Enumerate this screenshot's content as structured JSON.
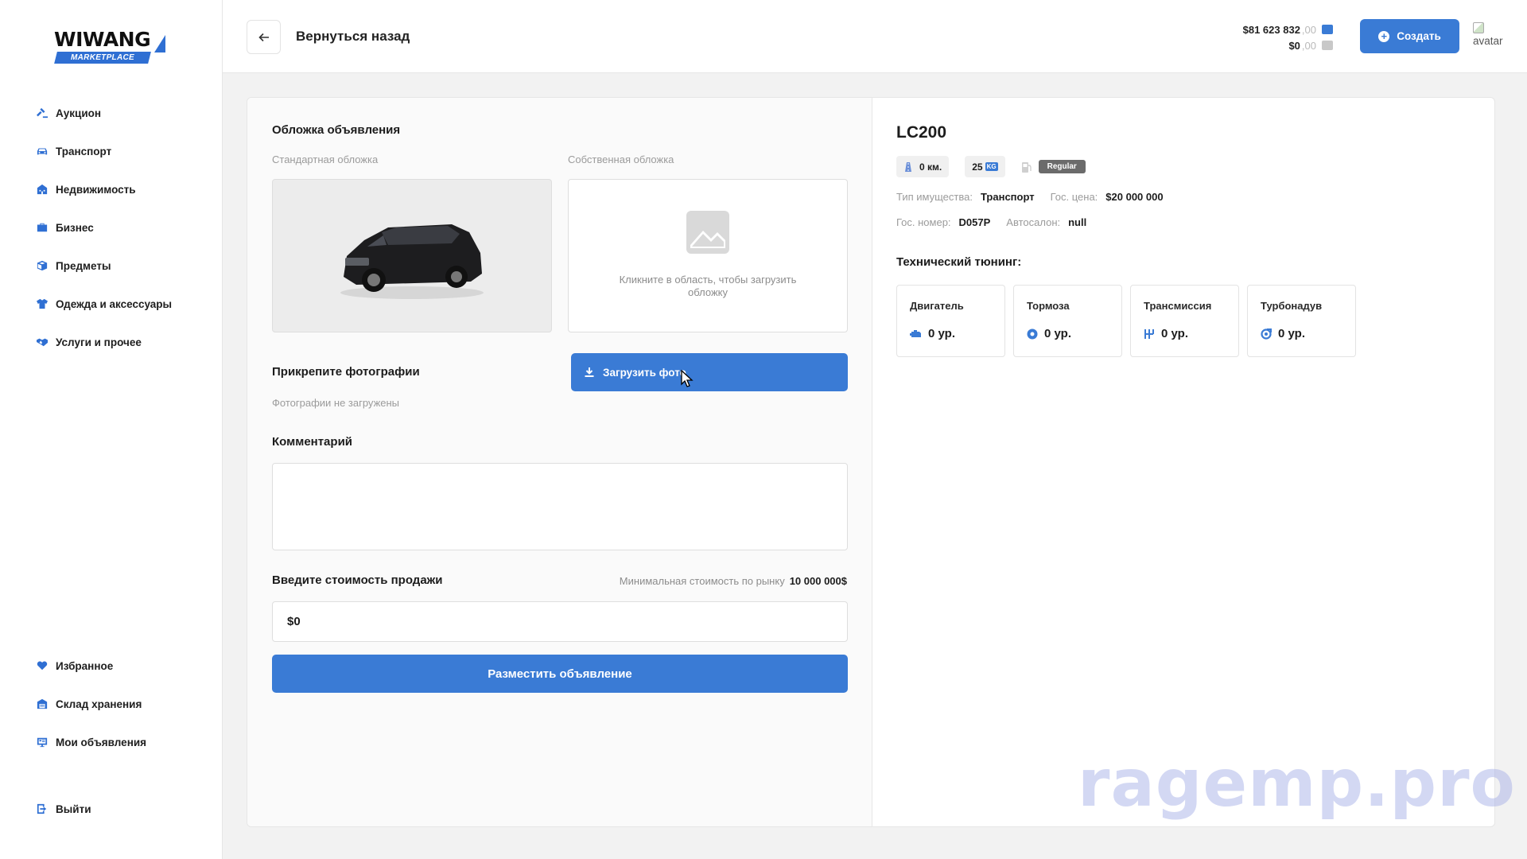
{
  "logo": {
    "brand": "WIWANG",
    "tag": "MARKETPLACE"
  },
  "sidebar": {
    "items": [
      {
        "label": "Аукцион",
        "icon": "gavel-icon"
      },
      {
        "label": "Транспорт",
        "icon": "car-icon"
      },
      {
        "label": "Недвижимость",
        "icon": "building-icon"
      },
      {
        "label": "Бизнес",
        "icon": "briefcase-icon"
      },
      {
        "label": "Предметы",
        "icon": "box-icon"
      },
      {
        "label": "Одежда и аксессуары",
        "icon": "shirt-icon"
      },
      {
        "label": "Услуги и прочее",
        "icon": "handshake-icon"
      }
    ],
    "bottom_items": [
      {
        "label": "Избранное",
        "icon": "heart-icon"
      },
      {
        "label": "Склад хранения",
        "icon": "warehouse-icon"
      },
      {
        "label": "Мои объявления",
        "icon": "listings-icon"
      }
    ],
    "logout": {
      "label": "Выйти",
      "icon": "logout-icon"
    }
  },
  "header": {
    "back_label": "Вернуться назад",
    "balance_main": "$81 623 832",
    "balance_main_cents": ",00",
    "balance_second": "$0",
    "balance_second_cents": ",00",
    "create_label": "Создать",
    "avatar_alt": "avatar"
  },
  "form": {
    "cover_title": "Обложка объявления",
    "standard_cover": "Стандартная обложка",
    "own_cover": "Собственная обложка",
    "own_cover_hint": "Кликните в область, чтобы загрузить обложку",
    "attach_title": "Прикрепите фотографии",
    "upload_label": "Загрузить фото",
    "no_photos": "Фотографии не загружены",
    "comment_title": "Комментарий",
    "comment_value": "",
    "price_title": "Введите стоимость продажи",
    "min_price_label": "Минимальная стоимость по рынку",
    "min_price_value": "10 000 000$",
    "price_value": "$0",
    "submit_label": "Разместить объявление"
  },
  "vehicle": {
    "name": "LC200",
    "mileage": "0 км.",
    "weight": "25",
    "weight_unit": "KG",
    "fuel": "Regular",
    "type_label": "Тип имущества:",
    "type_value": "Транспорт",
    "gov_price_label": "Гос. цена:",
    "gov_price_value": "$20 000 000",
    "plate_label": "Гос. номер:",
    "plate_value": "D057P",
    "dealer_label": "Автосалон:",
    "dealer_value": "null",
    "tuning_title": "Технический тюнинг:",
    "tuning": [
      {
        "name": "Двигатель",
        "value": "0 ур.",
        "icon": "engine-icon"
      },
      {
        "name": "Тормоза",
        "value": "0 ур.",
        "icon": "brake-icon"
      },
      {
        "name": "Трансмиссия",
        "value": "0 ур.",
        "icon": "gearbox-icon"
      },
      {
        "name": "Турбонадув",
        "value": "0 ур.",
        "icon": "turbo-icon"
      }
    ]
  },
  "watermark": "ragemp.pro",
  "colors": {
    "accent": "#3a7bd5",
    "background": "#f2f2f2"
  }
}
